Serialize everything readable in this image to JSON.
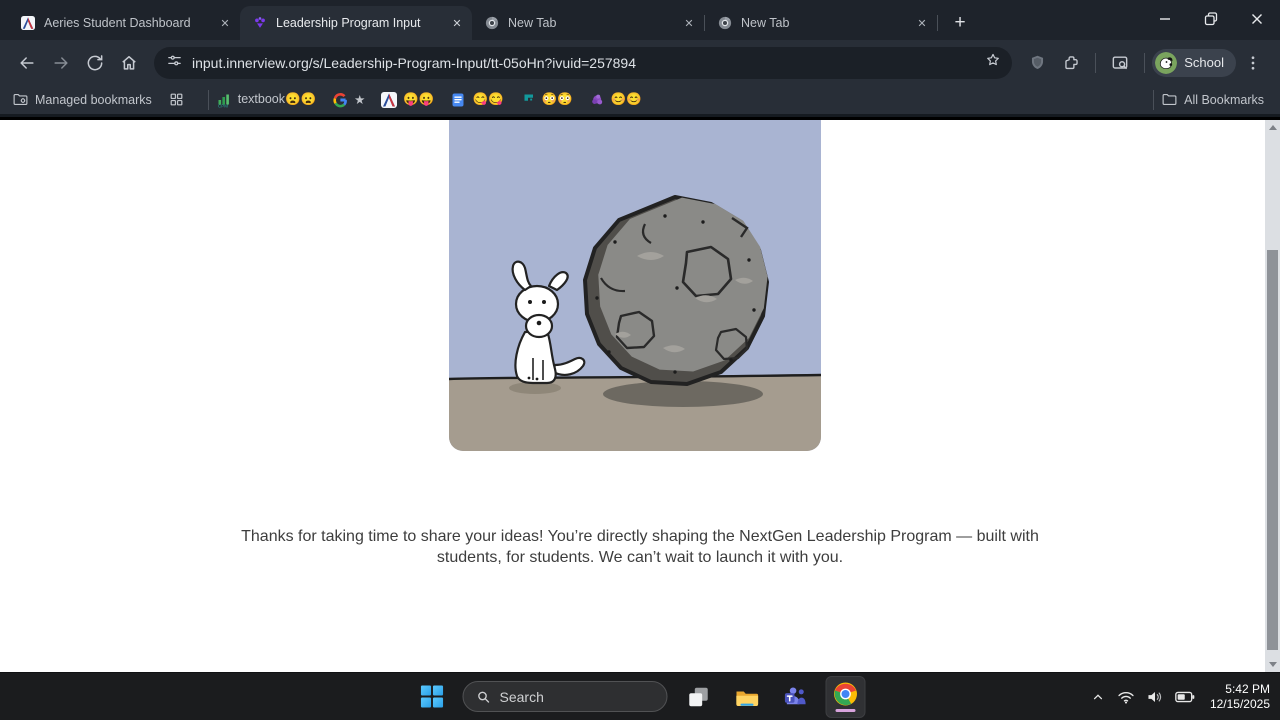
{
  "browser": {
    "tabs": [
      {
        "title": "Aeries Student Dashboard",
        "icon": "aeries-favicon",
        "active": false
      },
      {
        "title": "Leadership Program Input",
        "icon": "sparkle-favicon",
        "active": true
      },
      {
        "title": "New Tab",
        "icon": "chrome-gray-favicon",
        "active": false
      },
      {
        "title": "New Tab",
        "icon": "chrome-gray-favicon",
        "active": false
      }
    ],
    "toolbar": {
      "url": "input.innerview.org/s/Leadership-Program-Input/tt-05oHn?ivuid=257894",
      "profile_label": "School"
    },
    "bookmarks": {
      "managed_label": "Managed bookmarks",
      "all_bookmarks_label": "All Bookmarks",
      "items": [
        {
          "label": "textbook😦😦",
          "icon": "chart-favicon"
        },
        {
          "label": "★",
          "icon": "google-favicon"
        },
        {
          "label": "😛😛",
          "icon": "aeries-favicon"
        },
        {
          "label": "😋😋",
          "icon": "docs-favicon"
        },
        {
          "label": "😳😳",
          "icon": "formative-favicon"
        },
        {
          "label": "😊😊",
          "icon": "purple-favicon"
        }
      ]
    }
  },
  "page": {
    "message": "Thanks for taking  time to share your ideas! You’re directly shaping the NextGen Leadership Program — built with students, for students. We can’t wait to launch it with you.",
    "illustration_alt": "Cartoon of a small white dog sitting beside a giant gray boulder on a blue background"
  },
  "taskbar": {
    "search_placeholder": "Search",
    "clock": {
      "time": "5:42 PM",
      "date": "12/15/2025"
    }
  },
  "colors": {
    "tabstrip_bg": "#1e232b",
    "toolbar_bg": "#282e37",
    "omnibox_bg": "#1b2027",
    "page_bg": "#ffffff",
    "sky": "#a9b4d2",
    "ground": "#a59c8f",
    "taskbar_bg": "#1b1c1e",
    "chrome_underline": "#d8a3dc"
  }
}
